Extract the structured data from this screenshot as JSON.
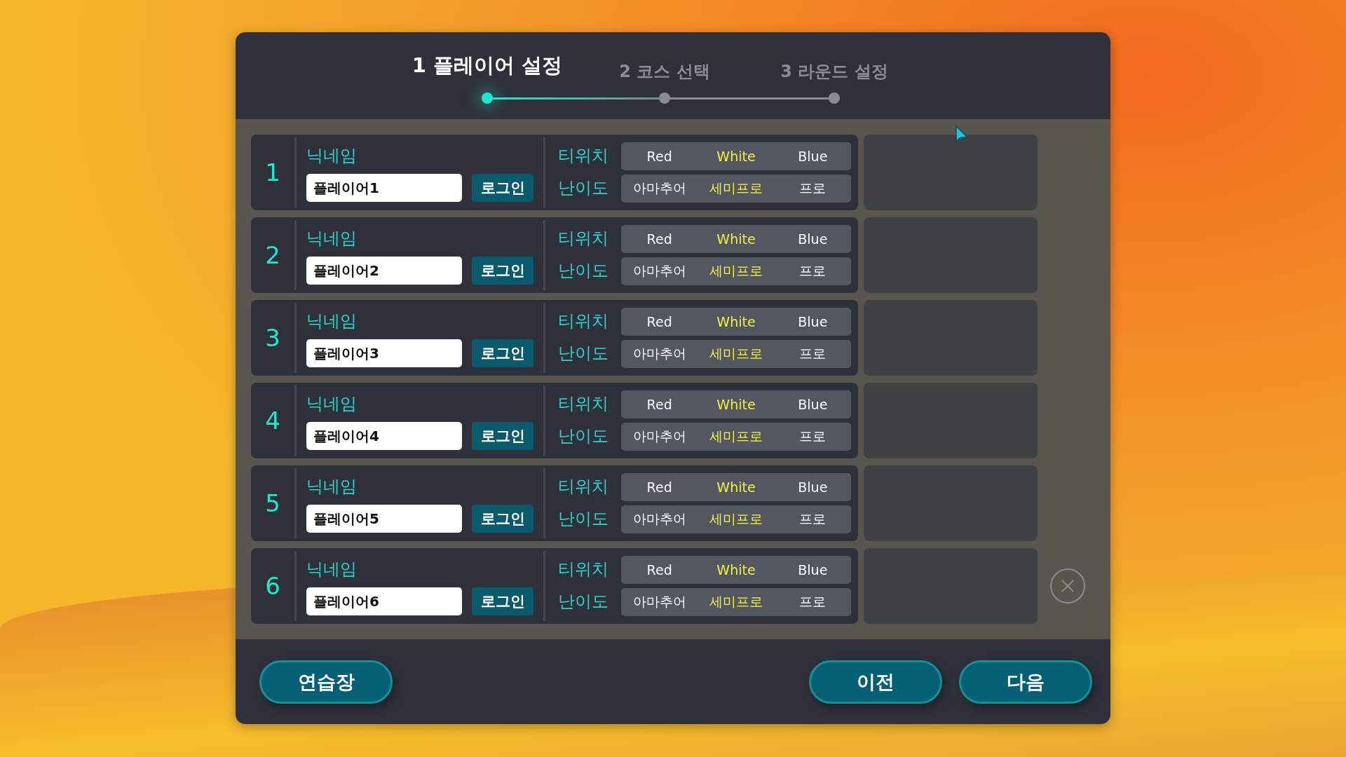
{
  "steps": [
    {
      "number": "1",
      "label": "플레이어 설정",
      "selected": true
    },
    {
      "number": "2",
      "label": "코스 선택",
      "selected": false
    },
    {
      "number": "3",
      "label": "라운드 설정",
      "selected": false
    }
  ],
  "players": [
    {
      "number": "1",
      "nickname_label": "닉네임",
      "nickname": "플레이어1",
      "login": "로그인",
      "tee_label": "티위치",
      "tees": [
        {
          "label": "Red",
          "selected": false
        },
        {
          "label": "White",
          "selected": true
        },
        {
          "label": "Blue",
          "selected": false
        }
      ],
      "difficulty_label": "난이도",
      "difficulties": [
        {
          "label": "아마추어",
          "selected": false
        },
        {
          "label": "세미프로",
          "selected": true
        },
        {
          "label": "프로",
          "selected": false
        }
      ],
      "removable": false
    },
    {
      "number": "2",
      "nickname_label": "닉네임",
      "nickname": "플레이어2",
      "login": "로그인",
      "tee_label": "티위치",
      "tees": [
        {
          "label": "Red",
          "selected": false
        },
        {
          "label": "White",
          "selected": true
        },
        {
          "label": "Blue",
          "selected": false
        }
      ],
      "difficulty_label": "난이도",
      "difficulties": [
        {
          "label": "아마추어",
          "selected": false
        },
        {
          "label": "세미프로",
          "selected": true
        },
        {
          "label": "프로",
          "selected": false
        }
      ],
      "removable": false
    },
    {
      "number": "3",
      "nickname_label": "닉네임",
      "nickname": "플레이어3",
      "login": "로그인",
      "tee_label": "티위치",
      "tees": [
        {
          "label": "Red",
          "selected": false
        },
        {
          "label": "White",
          "selected": true
        },
        {
          "label": "Blue",
          "selected": false
        }
      ],
      "difficulty_label": "난이도",
      "difficulties": [
        {
          "label": "아마추어",
          "selected": false
        },
        {
          "label": "세미프로",
          "selected": true
        },
        {
          "label": "프로",
          "selected": false
        }
      ],
      "removable": false
    },
    {
      "number": "4",
      "nickname_label": "닉네임",
      "nickname": "플레이어4",
      "login": "로그인",
      "tee_label": "티위치",
      "tees": [
        {
          "label": "Red",
          "selected": false
        },
        {
          "label": "White",
          "selected": true
        },
        {
          "label": "Blue",
          "selected": false
        }
      ],
      "difficulty_label": "난이도",
      "difficulties": [
        {
          "label": "아마추어",
          "selected": false
        },
        {
          "label": "세미프로",
          "selected": true
        },
        {
          "label": "프로",
          "selected": false
        }
      ],
      "removable": false
    },
    {
      "number": "5",
      "nickname_label": "닉네임",
      "nickname": "플레이어5",
      "login": "로그인",
      "tee_label": "티위치",
      "tees": [
        {
          "label": "Red",
          "selected": false
        },
        {
          "label": "White",
          "selected": true
        },
        {
          "label": "Blue",
          "selected": false
        }
      ],
      "difficulty_label": "난이도",
      "difficulties": [
        {
          "label": "아마추어",
          "selected": false
        },
        {
          "label": "세미프로",
          "selected": true
        },
        {
          "label": "프로",
          "selected": false
        }
      ],
      "removable": false
    },
    {
      "number": "6",
      "nickname_label": "닉네임",
      "nickname": "플레이어6",
      "login": "로그인",
      "tee_label": "티위치",
      "tees": [
        {
          "label": "Red",
          "selected": false
        },
        {
          "label": "White",
          "selected": true
        },
        {
          "label": "Blue",
          "selected": false
        }
      ],
      "difficulty_label": "난이도",
      "difficulties": [
        {
          "label": "아마추어",
          "selected": false
        },
        {
          "label": "세미프로",
          "selected": true
        },
        {
          "label": "프로",
          "selected": false
        }
      ],
      "removable": true
    }
  ],
  "footer": {
    "left_buttons": [
      "연습장"
    ],
    "right_buttons": [
      "이전",
      "다음"
    ]
  }
}
